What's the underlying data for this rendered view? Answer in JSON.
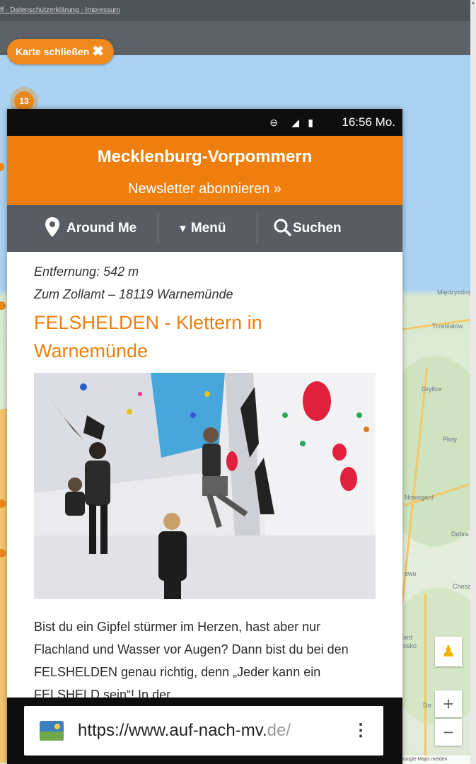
{
  "background_page": {
    "top_links": "ff · Datenschutzerklärung · Impressum",
    "close_map_label": "Karte schließen",
    "close_map_icon": "close-icon",
    "cluster_count": "13",
    "map_labels": [
      "Międzyzdroje",
      "Trzebiatów",
      "Gryfice",
      "Płoty",
      "Nowogard",
      "Dobra",
      "ewo",
      "Choszczno",
      "ard",
      "nsko",
      "Do"
    ],
    "zoom_in": "+",
    "zoom_out": "−",
    "map_footer": "Google Maps melden"
  },
  "phone": {
    "status_time": "16:56 Mo.",
    "site_title": "Mecklenburg-Vorpommern",
    "newsletter": "Newsletter abonnieren »",
    "nav": {
      "around_me": "Around Me",
      "menu": "Menü",
      "search": "Suchen"
    },
    "listing": {
      "distance": "Entfernung: 542 m",
      "address": "Zum Zollamt – 18119 Warnemünde",
      "title": "FELSHELDEN - Klettern in Warnemünde",
      "description": "Bist du ein Gipfel stürmer im Herzen, hast aber nur Flachland und Wasser vor Augen? Dann bist du bei den FELSHELDEN genau richtig, denn „Jeder kann ein FELSHELD sein“! In der"
    },
    "browser": {
      "url_main": "https://www.auf-nach-mv.",
      "url_dim": "de/"
    }
  },
  "colors": {
    "accent": "#ee7e0d",
    "nav_bg": "#595d63",
    "map_water": "#aad3f2"
  }
}
